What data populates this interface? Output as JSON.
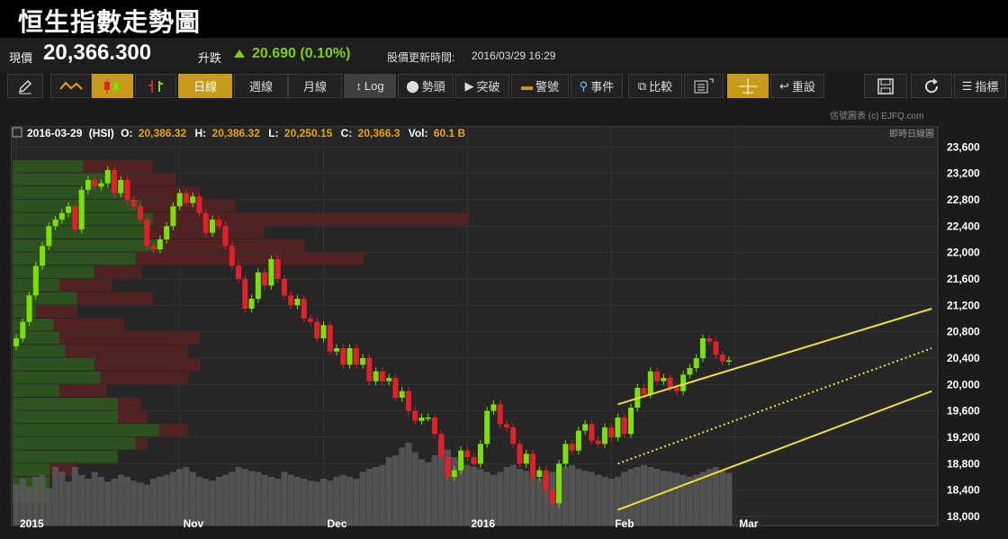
{
  "header": {
    "title": "恒生指數走勢圖"
  },
  "quote": {
    "price_label": "現價",
    "price": "20,366.300",
    "change_label": "升跌",
    "change": "20.690 (0.10%)",
    "update_label": "股價更新時間:",
    "update_time": "2016/03/29 16:29"
  },
  "toolbar": {
    "draw": "pencil-icon",
    "line": "line-chart-icon",
    "candle": "candlestick-icon",
    "ohlc": "ohlc-bar-icon",
    "daily": "日線",
    "weekly": "週線",
    "monthly": "月線",
    "log": "Log",
    "trend_head": "勢頭",
    "breakout": "突破",
    "alert": "警號",
    "event": "事件",
    "compare": "比較",
    "indicator": "指標",
    "crosshair": "crosshair-icon",
    "reset": "重設",
    "save": "save-icon",
    "refresh": "refresh-icon"
  },
  "credit": "信號圖表 (c) EJFQ.com",
  "info": {
    "date": "2016-03-29",
    "symbol": "(HSI)",
    "o_label": "O:",
    "o": "20,386.32",
    "h_label": "H:",
    "h": "20,386.32",
    "l_label": "L:",
    "l": "20,250.15",
    "c_label": "C:",
    "c": "20,366.3",
    "v_label": "Vol:",
    "v": "60.1 B",
    "mode": "即時日線圖"
  },
  "colors": {
    "up": "#7ae000",
    "down": "#e0202a",
    "channel": "#f0e030",
    "accent": "#c79b17"
  },
  "chart_data": {
    "type": "candlestick",
    "ylim": [
      18000,
      23700
    ],
    "yticks": [
      18000,
      18400,
      18800,
      19200,
      19600,
      20000,
      20400,
      20800,
      21200,
      21600,
      22000,
      22400,
      22800,
      23200,
      23600
    ],
    "ytick_labels": [
      "18,000",
      "18,400",
      "18,800",
      "19,200",
      "19,600",
      "20,000",
      "20,400",
      "20,800",
      "21,200",
      "21,600",
      "22,000",
      "22,400",
      "22,800",
      "23,200",
      "23,600"
    ],
    "xticks": [
      {
        "label": "2015",
        "bar": 0
      },
      {
        "label": "Nov",
        "bar": 25
      },
      {
        "label": "Dec",
        "bar": 47
      },
      {
        "label": "2016",
        "bar": 69
      },
      {
        "label": "Feb",
        "bar": 91
      },
      {
        "label": "Mar",
        "bar": 110
      }
    ],
    "closes": [
      20700,
      20950,
      21350,
      21800,
      22100,
      22400,
      22500,
      22600,
      22700,
      22350,
      22950,
      23100,
      23000,
      23050,
      23250,
      22900,
      23100,
      22800,
      22700,
      22500,
      22100,
      22050,
      22200,
      22400,
      22700,
      22900,
      22750,
      22850,
      22600,
      22300,
      22500,
      22400,
      22100,
      21800,
      21600,
      21150,
      21300,
      21700,
      21500,
      21900,
      21600,
      21350,
      21200,
      21300,
      21000,
      20950,
      20700,
      20900,
      20500,
      20550,
      20300,
      20550,
      20300,
      20400,
      20050,
      20200,
      20050,
      20100,
      19800,
      19900,
      19600,
      19450,
      19500,
      19500,
      19250,
      18900,
      18600,
      18700,
      19000,
      18900,
      18800,
      19100,
      19600,
      19700,
      19400,
      19350,
      19100,
      18800,
      18950,
      18600,
      18700,
      18400,
      18200,
      18800,
      19100,
      19000,
      19300,
      19400,
      19150,
      19100,
      19350,
      19200,
      19500,
      19250,
      19650,
      19950,
      19850,
      20200,
      20050,
      20100,
      19950,
      19900,
      20150,
      20250,
      20400,
      20700,
      20650,
      20450,
      20350,
      20366
    ],
    "volume_label": "Vol",
    "volume_max_bn": 120,
    "volumes_bn": [
      42,
      48,
      40,
      50,
      52,
      38,
      60,
      55,
      45,
      60,
      52,
      48,
      55,
      50,
      45,
      48,
      52,
      50,
      46,
      44,
      42,
      48,
      50,
      52,
      55,
      58,
      60,
      55,
      50,
      48,
      46,
      50,
      52,
      55,
      60,
      58,
      56,
      55,
      52,
      50,
      48,
      55,
      52,
      50,
      48,
      46,
      45,
      48,
      46,
      50,
      52,
      50,
      48,
      55,
      58,
      60,
      62,
      70,
      72,
      80,
      85,
      75,
      68,
      65,
      72,
      88,
      78,
      70,
      66,
      62,
      60,
      58,
      55,
      52,
      55,
      60,
      62,
      58,
      56,
      50,
      48,
      52,
      55,
      58,
      60,
      62,
      58,
      56,
      55,
      52,
      50,
      48,
      50,
      55,
      58,
      60,
      62,
      60,
      58,
      56,
      55,
      54,
      52,
      50,
      52,
      55,
      58,
      60,
      56,
      54
    ],
    "volume_by_price": [
      {
        "lo": 23200,
        "hi": 23400,
        "up": 60,
        "down": 120
      },
      {
        "lo": 23000,
        "hi": 23200,
        "up": 85,
        "down": 140
      },
      {
        "lo": 22800,
        "hi": 23000,
        "up": 95,
        "down": 160
      },
      {
        "lo": 22600,
        "hi": 22800,
        "up": 110,
        "down": 190
      },
      {
        "lo": 22400,
        "hi": 22600,
        "up": 120,
        "down": 390
      },
      {
        "lo": 22200,
        "hi": 22400,
        "up": 115,
        "down": 215
      },
      {
        "lo": 22000,
        "hi": 22200,
        "up": 125,
        "down": 250
      },
      {
        "lo": 21800,
        "hi": 22000,
        "up": 105,
        "down": 300
      },
      {
        "lo": 21600,
        "hi": 21800,
        "up": 70,
        "down": 110
      },
      {
        "lo": 21400,
        "hi": 21600,
        "up": 40,
        "down": 85
      },
      {
        "lo": 21200,
        "hi": 21400,
        "up": 55,
        "down": 120
      },
      {
        "lo": 21000,
        "hi": 21200,
        "up": 20,
        "down": 55
      },
      {
        "lo": 20800,
        "hi": 21000,
        "up": 35,
        "down": 95
      },
      {
        "lo": 20600,
        "hi": 20800,
        "up": 40,
        "down": 160
      },
      {
        "lo": 20400,
        "hi": 20600,
        "up": 45,
        "down": 150
      },
      {
        "lo": 20200,
        "hi": 20400,
        "up": 70,
        "down": 160
      },
      {
        "lo": 20000,
        "hi": 20200,
        "up": 75,
        "down": 150
      },
      {
        "lo": 19800,
        "hi": 20000,
        "up": 40,
        "down": 80
      },
      {
        "lo": 19600,
        "hi": 19800,
        "up": 90,
        "down": 110
      },
      {
        "lo": 19400,
        "hi": 19600,
        "up": 90,
        "down": 115
      },
      {
        "lo": 19200,
        "hi": 19400,
        "up": 125,
        "down": 150
      },
      {
        "lo": 19000,
        "hi": 19200,
        "up": 105,
        "down": 115
      },
      {
        "lo": 18800,
        "hi": 19000,
        "up": 90,
        "down": 90
      },
      {
        "lo": 18600,
        "hi": 18800,
        "up": 32,
        "down": 55
      },
      {
        "lo": 18400,
        "hi": 18600,
        "up": 32,
        "down": 0
      },
      {
        "lo": 18200,
        "hi": 18400,
        "up": 32,
        "down": 0
      }
    ],
    "channel": {
      "upper": [
        [
          92,
          19700
        ],
        [
          140,
          21150
        ]
      ],
      "mid": [
        [
          92,
          18800
        ],
        [
          140,
          20550
        ]
      ],
      "lower": [
        [
          92,
          18100
        ],
        [
          140,
          19900
        ]
      ]
    }
  }
}
